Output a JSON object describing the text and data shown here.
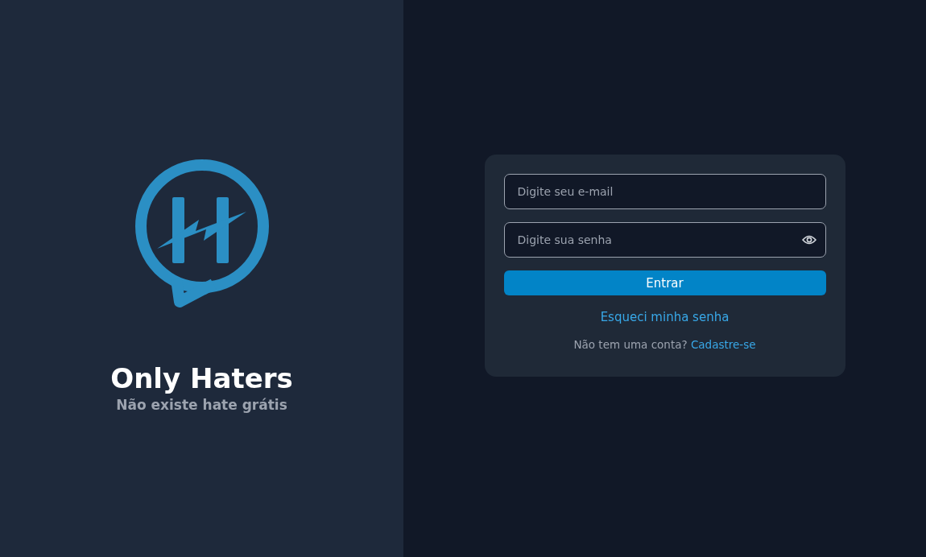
{
  "brand": {
    "title": "Only Haters",
    "subtitle": "Não existe hate grátis"
  },
  "login": {
    "fields": [
      {
        "kind": "email",
        "placeholder": "Digite seu e-mail"
      },
      {
        "kind": "password",
        "placeholder": "Digite sua senha"
      }
    ],
    "submit": "Entrar",
    "forgot_link": "Esqueci minha senha",
    "signup": {
      "prompt": "Não tem uma conta?",
      "link": "Cadastre-se"
    }
  }
}
